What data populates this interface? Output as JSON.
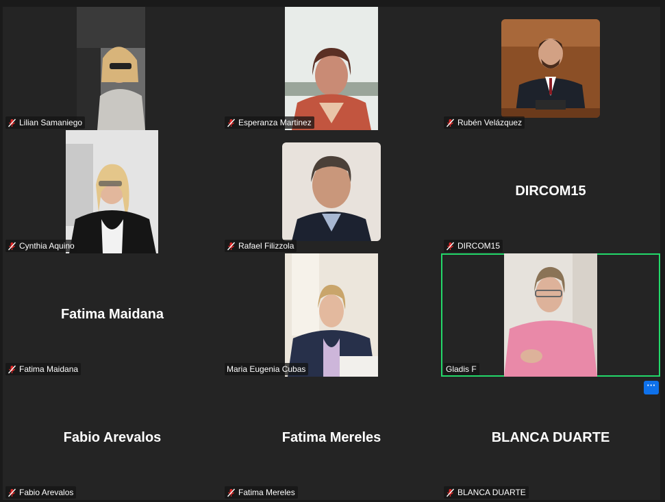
{
  "participants": [
    {
      "name": "Lilian Samaniego",
      "video": true
    },
    {
      "name": "Esperanza Martinez",
      "video": true
    },
    {
      "name": "Rubén Velázquez",
      "video": true
    },
    {
      "name": "Cynthia Aquino",
      "video": true
    },
    {
      "name": "Rafael Filizzola",
      "video": true
    },
    {
      "name": "DIRCOM15",
      "video": false,
      "display_name": "DIRCOM15"
    },
    {
      "name": "Fatima Maidana",
      "video": false,
      "display_name": "Fatima Maidana"
    },
    {
      "name": "Maria Eugenia Cubas",
      "video": true
    },
    {
      "name": "Gladis F",
      "video": true,
      "active_speaker": true
    },
    {
      "name": "Fabio Arevalos",
      "video": false,
      "display_name": "Fabio Arevalos"
    },
    {
      "name": "Fatima Mereles",
      "video": false,
      "display_name": "Fatima Mereles"
    },
    {
      "name": "BLANCA DUARTE",
      "video": false,
      "display_name": "BLANCA DUARTE"
    }
  ],
  "more_button_label": "···",
  "colors": {
    "background": "#1a1a1a",
    "tile": "#242424",
    "speaker_outline": "#23d96a",
    "muted_icon": "#e02828",
    "accent": "#0e71eb"
  },
  "icons": {
    "muted": "mic-muted-icon",
    "more": "more-options-icon"
  }
}
